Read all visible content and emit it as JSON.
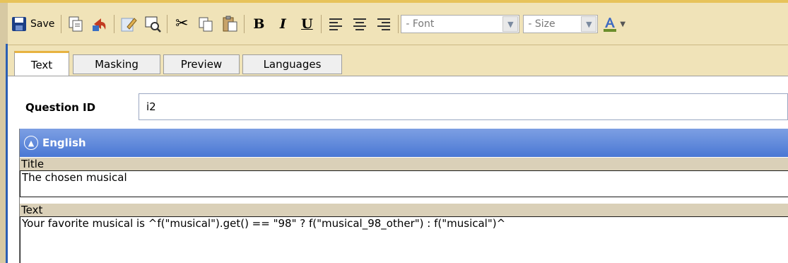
{
  "toolbar": {
    "save_label": "Save",
    "font_select": {
      "value": "- Font"
    },
    "size_select": {
      "value": "- Size"
    },
    "icons": [
      "save-icon",
      "copy-icon",
      "cut-icon",
      "edit-icon",
      "preview-icon",
      "scissors-icon",
      "clipboard-copy-icon",
      "paste-icon",
      "bold-icon",
      "italic-icon",
      "underline-icon",
      "align-left-icon",
      "align-center-icon",
      "align-right-icon",
      "font-color-icon"
    ]
  },
  "tabs": [
    {
      "label": "Text",
      "active": true
    },
    {
      "label": "Masking",
      "active": false
    },
    {
      "label": "Preview",
      "active": false
    },
    {
      "label": "Languages",
      "active": false
    }
  ],
  "question": {
    "id_label": "Question ID",
    "id_value": "i2"
  },
  "section": {
    "title": "English",
    "title_field": {
      "label": "Title",
      "value": "The chosen musical"
    },
    "text_field": {
      "label": "Text",
      "value": "Your favorite musical is ^f(\"musical\").get() == \"98\" ? f(\"musical_98_other\") : f(\"musical\")^"
    }
  },
  "colors": {
    "toolbar_bg": "#f0e3b8",
    "section_header": "#4a78d4",
    "active_tab_accent": "#e7b341"
  }
}
